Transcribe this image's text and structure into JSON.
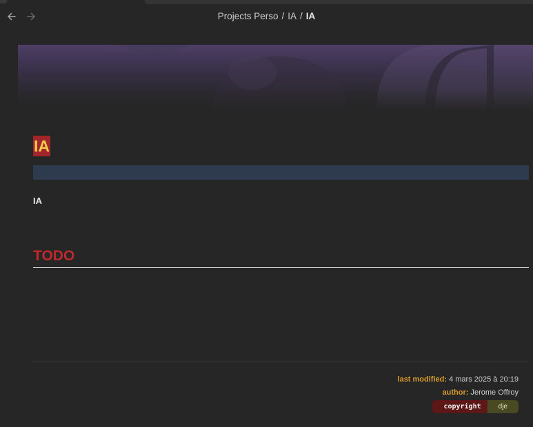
{
  "nav": {
    "back_icon": "arrow-left-icon",
    "forward_icon": "arrow-right-icon"
  },
  "breadcrumb": {
    "items": [
      "Projects Perso",
      "IA",
      "IA"
    ],
    "separator": "/"
  },
  "note": {
    "title": "IA",
    "body": "IA",
    "todo_heading": "TODO"
  },
  "footer": {
    "last_modified_label": "last modified:",
    "last_modified_value": "4 mars 2025 à 20:19",
    "author_label": "author:",
    "author_value": "Jerome Offroy"
  },
  "badge": {
    "left": "copyright",
    "right": "dje"
  },
  "colors": {
    "background": "#262626",
    "title_bg": "#a2252a",
    "title_fg": "#f2c94c",
    "todo": "#c0282b",
    "footer_label": "#d89b2b",
    "meta_strip": "#2e3a4d"
  }
}
